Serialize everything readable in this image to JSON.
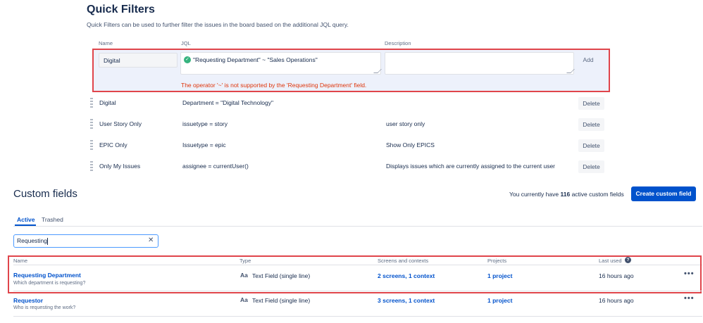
{
  "quick_filters": {
    "title": "Quick Filters",
    "description": "Quick Filters can be used to further filter the issues in the board based on the additional JQL query.",
    "columns": {
      "name": "Name",
      "jql": "JQL",
      "description": "Description"
    },
    "new_filter": {
      "name_value": "Digital",
      "jql_value": "\"Requesting Department\" ~ \"Sales Operations\"",
      "description_value": "",
      "add_label": "Add",
      "error": "The operator '~' is not supported by the 'Requesting Department' field."
    },
    "rows": [
      {
        "name": "Digital",
        "jql": "Department = \"Digital Technology\"",
        "description": "",
        "delete_label": "Delete"
      },
      {
        "name": "User Story Only",
        "jql": "issuetype = story",
        "description": "user story only",
        "delete_label": "Delete"
      },
      {
        "name": "EPIC Only",
        "jql": "Issuetype = epic",
        "description": "Show Only EPICS",
        "delete_label": "Delete"
      },
      {
        "name": "Only My Issues",
        "jql": "assignee = currentUser()",
        "description": "Displays issues which are currently assigned to the current user",
        "delete_label": "Delete"
      }
    ]
  },
  "custom_fields": {
    "title": "Custom fields",
    "count_prefix": "You currently have",
    "count": "116",
    "count_suffix": "active custom fields",
    "create_label": "Create custom field",
    "tabs": {
      "active": "Active",
      "trashed": "Trashed"
    },
    "search_value": "Requesting",
    "clear_icon": "✕",
    "columns": {
      "name": "Name",
      "type": "Type",
      "screens": "Screens and contexts",
      "projects": "Projects",
      "last_used": "Last used",
      "help_icon": "?"
    },
    "rows": [
      {
        "name": "Requesting Department",
        "description": "Which department is requesting?",
        "type_icon": "Aa",
        "type": "Text Field (single line)",
        "screens": "2 screens, 1 context",
        "projects": "1 project",
        "last_used": "16 hours ago",
        "more": "•••"
      },
      {
        "name": "Requestor",
        "description": "Who is requesting the work?",
        "type_icon": "Aa",
        "type": "Text Field (single line)",
        "screens": "3 screens, 1 context",
        "projects": "1 project",
        "last_used": "16 hours ago",
        "more": "•••"
      }
    ]
  },
  "colors": {
    "accent": "#0052cc",
    "error": "#de350b",
    "highlight_border": "#e0454b",
    "success": "#36b37e"
  }
}
